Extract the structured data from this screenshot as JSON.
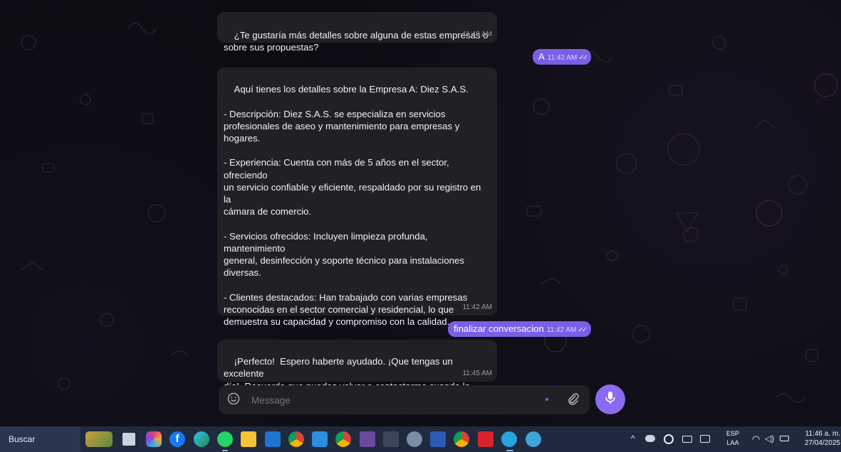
{
  "messages": [
    {
      "dir": "in",
      "text": "¿Te gustaría más detalles sobre alguna de estas empresas o\nsobre sus propuestas?",
      "time": "11:40 AM"
    },
    {
      "dir": "out",
      "text": "A",
      "time": "11:42 AM",
      "status": "read-double-check"
    },
    {
      "dir": "in",
      "text": "Aquí tienes los detalles sobre la Empresa A: Diez S.A.S.\n\n- Descripción: Diez S.A.S. se especializa en servicios\nprofesionales de aseo y mantenimiento para empresas y\nhogares.\n\n- Experiencia: Cuenta con más de 5 años en el sector, ofreciendo\nun servicio confiable y eficiente, respaldado por su registro en la\ncámara de comercio.\n\n- Servicios ofrecidos: Incluyen limpieza profunda, mantenimiento\ngeneral, desinfección y soporte técnico para instalaciones\ndiversas.\n\n- Clientes destacados: Han trabajado con varias empresas\nreconocidas en el sector comercial y residencial, lo que\ndemuestra su capacidad y compromiso con la calidad.\n\n¿Necesitas algo más? Puedes volver al menú principal o\npreguntar sobre otra cosa.",
      "time": "11:42 AM"
    },
    {
      "dir": "out",
      "text": "finalizar conversacion",
      "time": "11:42 AM",
      "status": "read-double-check"
    },
    {
      "dir": "in",
      "text": "¡Perfecto!  Espero haberte ayudado. ¡Que tengas un excelente\ndía!  Recuerda que puedes volver a contactarme cuando lo\nnecesites.",
      "time": "11:45 AM"
    }
  ],
  "composer": {
    "placeholder": "Message",
    "emoji_icon": "smiley-icon",
    "attach_icon": "paperclip-icon",
    "mic_icon": "microphone-icon"
  },
  "taskbar": {
    "search_label": "Buscar",
    "apps": [
      "photo-app-icon",
      "file-app-icon",
      "colorful-app-icon",
      "facebook-icon",
      "edge-icon",
      "whatsapp-icon",
      "file-explorer-icon",
      "outlook-icon",
      "chrome-icon",
      "vscode-icon",
      "chrome-icon",
      "winrar-icon",
      "terminal-icon",
      "settings-icon",
      "word-icon",
      "chrome-icon",
      "acrobat-icon",
      "telegram-icon",
      "app-icon"
    ],
    "tray": {
      "language_top": "ESP",
      "language_bottom": "LAA",
      "time": "11:46 a. m.",
      "date": "27/04/2025"
    }
  },
  "colors": {
    "incoming_bubble": "#212125",
    "outgoing_bubble": "#7a5fe6",
    "mic_button": "#8b6cf0",
    "taskbar": "#1f2a3e"
  }
}
